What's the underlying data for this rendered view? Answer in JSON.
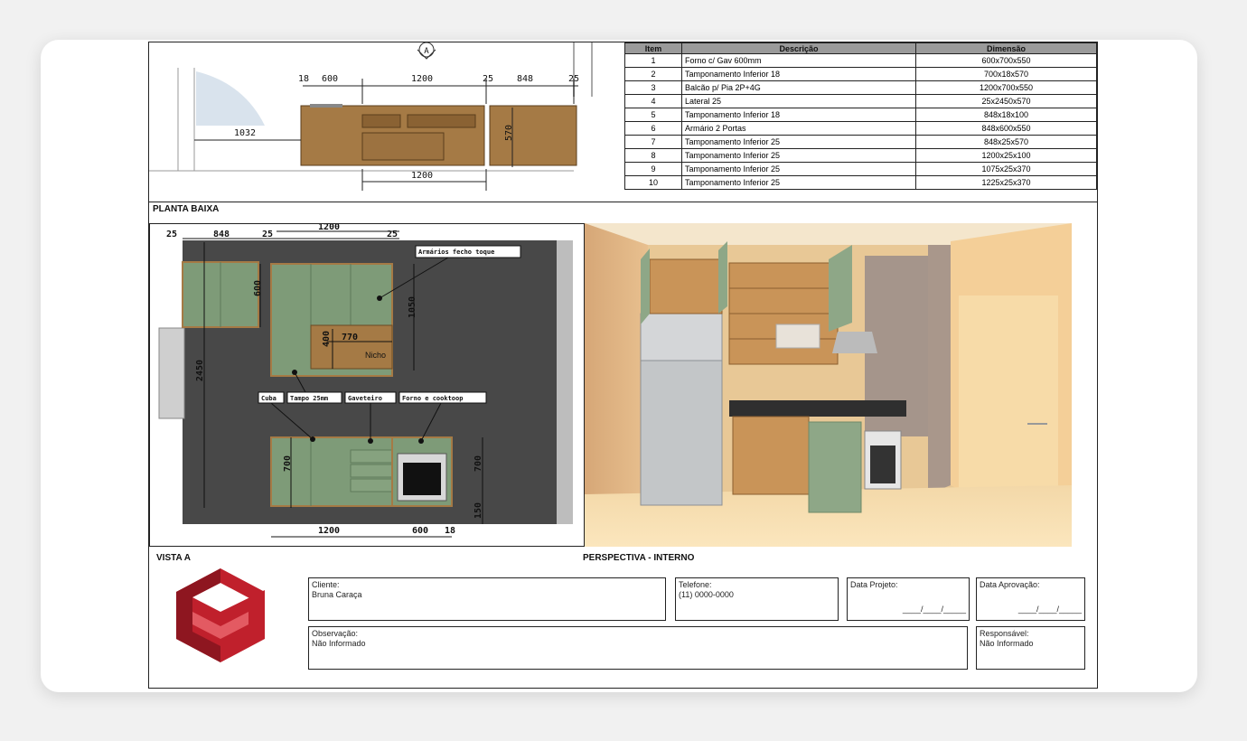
{
  "table": {
    "headers": [
      "Item",
      "Descrição",
      "Dimensão"
    ],
    "rows": [
      {
        "item": "1",
        "desc": "Forno c/ Gav 600mm",
        "dim": "600x700x550"
      },
      {
        "item": "2",
        "desc": "Tamponamento Inferior 18",
        "dim": "700x18x570"
      },
      {
        "item": "3",
        "desc": "Balcão p/ Pia 2P+4G",
        "dim": "1200x700x550"
      },
      {
        "item": "4",
        "desc": "Lateral 25",
        "dim": "25x2450x570"
      },
      {
        "item": "5",
        "desc": "Tamponamento Inferior 18",
        "dim": "848x18x100"
      },
      {
        "item": "6",
        "desc": "Armário 2 Portas",
        "dim": "848x600x550"
      },
      {
        "item": "7",
        "desc": "Tamponamento Inferior 25",
        "dim": "848x25x570"
      },
      {
        "item": "8",
        "desc": "Tamponamento Inferior 25",
        "dim": "1200x25x100"
      },
      {
        "item": "9",
        "desc": "Tamponamento Inferior 25",
        "dim": "1075x25x370"
      },
      {
        "item": "10",
        "desc": "Tamponamento Inferior 25",
        "dim": "1225x25x370"
      }
    ]
  },
  "plan": {
    "title": "PLANTA BAIXA",
    "marker": "A",
    "dims": {
      "d18": "18",
      "d600": "600",
      "d1200": "1200",
      "d25a": "25",
      "d848": "848",
      "d25b": "25",
      "d1032": "1032",
      "d570": "570",
      "d1200b": "1200"
    }
  },
  "elevation": {
    "title": "VISTA A",
    "dims": {
      "t25a": "25",
      "t848": "848",
      "t25b": "25",
      "t1200": "1200",
      "t25c": "25",
      "v600": "600",
      "v1050": "1050",
      "v2450": "2450",
      "v400": "400",
      "v770": "770",
      "v700a": "700",
      "v700b": "700",
      "v150": "150",
      "b1200": "1200",
      "b600": "600",
      "b18": "18"
    },
    "nicho": "Nicho",
    "tags": {
      "armarios": "Armários fecho toque",
      "cuba": "Cuba",
      "tampo": "Tampo 25mm",
      "gaveteiro": "Gaveteiro",
      "forno": "Forno e cooktoop"
    }
  },
  "perspective": {
    "title": "PERSPECTIVA - INTERNO"
  },
  "footer": {
    "cliente_label": "Cliente:",
    "cliente_value": "Bruna Caraça",
    "telefone_label": "Telefone:",
    "telefone_value": "(11) 0000-0000",
    "data_projeto_label": "Data Projeto:",
    "data_projeto_value": "____/____/_____",
    "data_aprovacao_label": "Data Aprovação:",
    "data_aprovacao_value": "____/____/_____",
    "observacao_label": "Observação:",
    "observacao_value": "Não Informado",
    "responsavel_label": "Responsável:",
    "responsavel_value": "Não Informado"
  },
  "colors": {
    "wood": "#a57a45",
    "green": "#7e9b78",
    "wall": "#484848",
    "logo": "#c0202c"
  }
}
